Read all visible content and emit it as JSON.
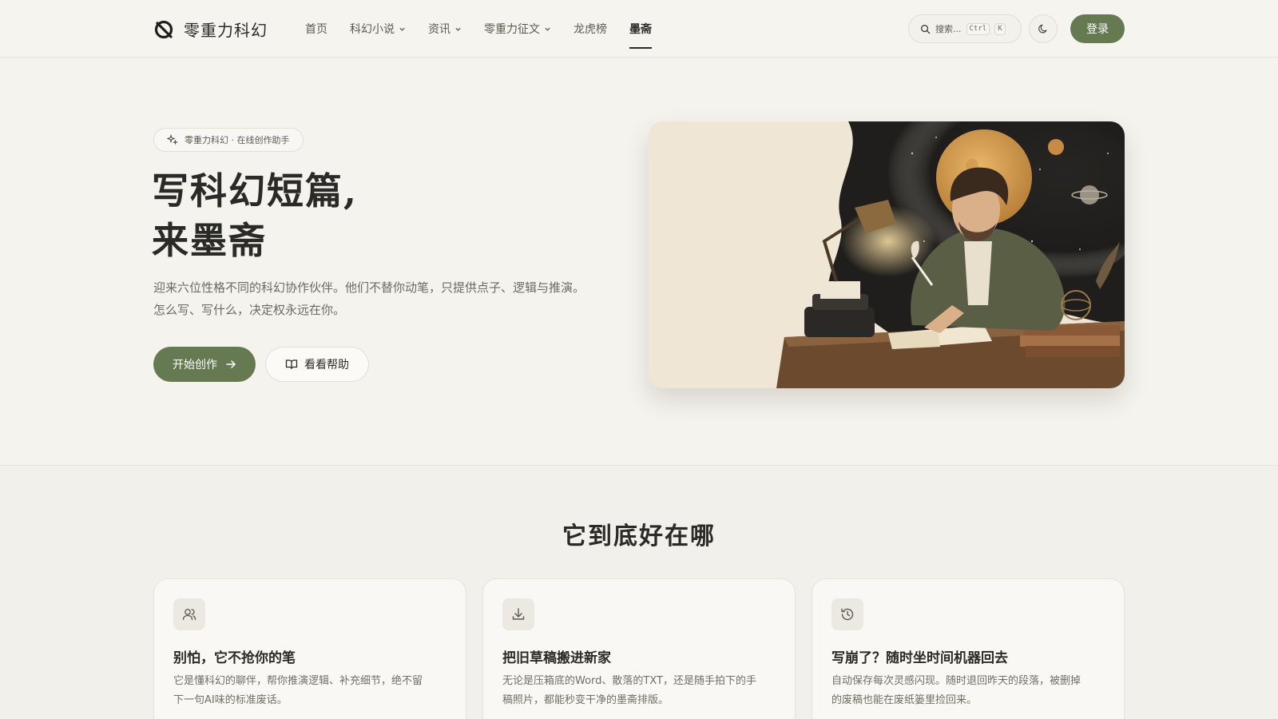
{
  "header": {
    "logo_text": "零重力科幻",
    "nav": [
      {
        "label": "首页",
        "dropdown": false,
        "active": false
      },
      {
        "label": "科幻小说",
        "dropdown": true,
        "active": false
      },
      {
        "label": "资讯",
        "dropdown": true,
        "active": false
      },
      {
        "label": "零重力征文",
        "dropdown": true,
        "active": false
      },
      {
        "label": "龙虎榜",
        "dropdown": false,
        "active": false
      },
      {
        "label": "墨斋",
        "dropdown": false,
        "active": true
      }
    ],
    "search_placeholder": "搜索...",
    "search_kbd": [
      "Ctrl",
      "K"
    ],
    "login_label": "登录"
  },
  "hero": {
    "badge": "零重力科幻 · 在线创作助手",
    "title_lines": [
      "写科幻短篇,",
      "来墨斋"
    ],
    "desc_lines": [
      "迎来六位性格不同的科幻协作伙伴。他们不替你动笔，只提供点子、逻辑与推演。",
      "怎么写、写什么，决定权永远在你。"
    ],
    "primary_button": "开始创作",
    "secondary_button": "看看帮助"
  },
  "features": {
    "title": "它到底好在哪",
    "cards": [
      {
        "icon": "users-icon",
        "title": "别怕，它不抢你的笔",
        "desc_lines": [
          "它是懂科幻的聊伴，帮你推演逻辑、补充细节，绝不留",
          "下一句AI味的标准废话。"
        ]
      },
      {
        "icon": "download-icon",
        "title": "把旧草稿搬进新家",
        "desc_lines": [
          "无论是压箱底的Word、散落的TXT，还是随手拍下的手",
          "稿照片，都能秒变干净的墨斋排版。"
        ]
      },
      {
        "icon": "history-icon",
        "title": "写崩了？随时坐时间机器回去",
        "desc_lines": [
          "自动保存每次灵感闪现。随时退回昨天的段落，被删掉",
          "的废稿也能在废纸篓里捡回来。"
        ]
      }
    ]
  },
  "colors": {
    "background": "#f5f3ee",
    "accent": "#667a52",
    "text": "#2a2a26"
  }
}
